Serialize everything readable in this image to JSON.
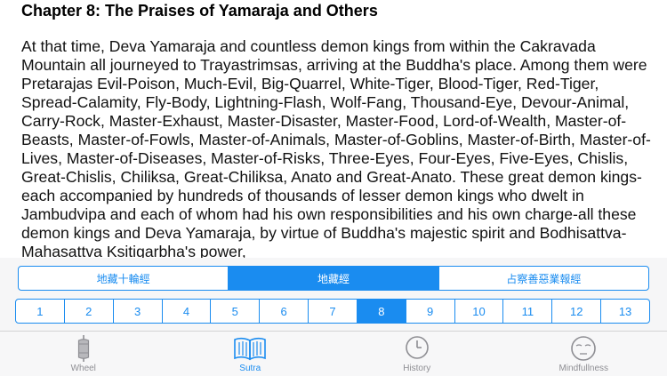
{
  "reader": {
    "chapter_title": "Chapter 8: The Praises of Yamaraja and Others",
    "text": "At that time, Deva Yamaraja and countless demon kings from within the Cakravada Mountain all journeyed to Trayastrimsas, arriving at the Buddha's place. Among them were Pretarajas Evil-Poison, Much-Evil, Big-Quarrel, White-Tiger, Blood-Tiger, Red-Tiger, Spread-Calamity, Fly-Body, Lightning-Flash, Wolf-Fang, Thousand-Eye, Devour-Animal, Carry-Rock, Master-Exhaust, Master-Disaster, Master-Food, Lord-of-Wealth, Master-of-Beasts, Master-of-Fowls, Master-of-Animals, Master-of-Goblins, Master-of-Birth, Master-of-Lives, Master-of-Diseases, Master-of-Risks, Three-Eyes, Four-Eyes, Five-Eyes, Chislis, Great-Chislis, Chiliksa, Great-Chiliksa, Anato and Great-Anato. These great demon kings-each accompanied by hundreds of thousands of lesser demon kings who dwelt in Jambudvipa and each of whom had his own responsibilities and his own charge-all these demon kings and Deva Yamaraja, by virtue of Buddha's majestic spirit and Bodhisattva-Mahasattva Ksitigarbha's power,"
  },
  "sutra_selector": {
    "items": [
      "地藏十輪經",
      "地藏經",
      "占察善惡業報經"
    ],
    "selected_index": 1
  },
  "chapter_selector": {
    "items": [
      "1",
      "2",
      "3",
      "4",
      "5",
      "6",
      "7",
      "8",
      "9",
      "10",
      "11",
      "12",
      "13"
    ],
    "selected": "8"
  },
  "tabbar": {
    "tabs": [
      {
        "label": "Wheel",
        "icon": "prayer-wheel-icon"
      },
      {
        "label": "Sutra",
        "icon": "open-book-icon"
      },
      {
        "label": "History",
        "icon": "clock-icon"
      },
      {
        "label": "Mindfullness",
        "icon": "meditation-face-icon"
      }
    ],
    "active": "Sutra"
  },
  "colors": {
    "accent": "#1a8cf0",
    "inactive_tab": "#8e8e93",
    "panel_background": "#f6f6f7"
  }
}
